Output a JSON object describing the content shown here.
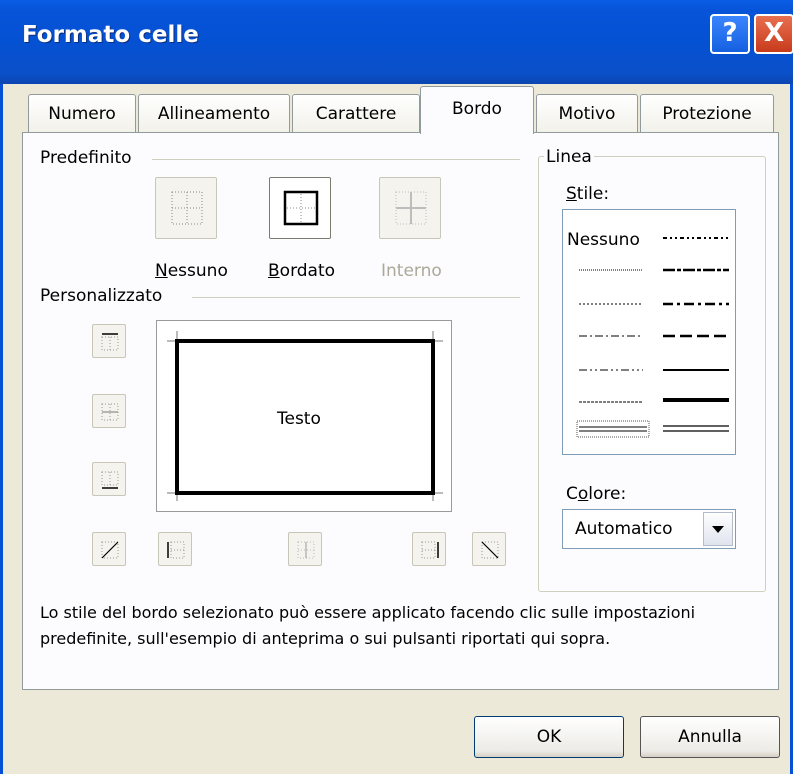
{
  "window": {
    "title": "Formato celle",
    "help_glyph": "?",
    "close_glyph": "X"
  },
  "tabs": [
    {
      "label": "Numero"
    },
    {
      "label": "Allineamento"
    },
    {
      "label": "Carattere"
    },
    {
      "label": "Bordo",
      "active": true
    },
    {
      "label": "Motivo"
    },
    {
      "label": "Protezione"
    }
  ],
  "predefinito": {
    "group_label": "Predefinito",
    "presets": [
      {
        "label_first": "N",
        "label_rest": "essuno",
        "icon": "preset-none-icon"
      },
      {
        "label_first": "B",
        "label_rest": "ordato",
        "icon": "preset-outline-icon"
      },
      {
        "label": "Interno",
        "icon": "preset-inside-icon",
        "disabled": true
      }
    ]
  },
  "personalizzato": {
    "group_label": "Personalizzato",
    "preview_text": "Testo"
  },
  "linea": {
    "group_label": "Linea",
    "stile_first": "S",
    "stile_rest": "tile:",
    "stile_none_option": "Nessuno",
    "colore_head": "C",
    "colore_underlined": "o",
    "colore_rest": "lore:",
    "colore_value": "Automatico"
  },
  "hint_text": "Lo stile del bordo selezionato può essere applicato facendo clic sulle impostazioni predefinite, sull'esempio di anteprima o sui pulsanti riportati qui sopra.",
  "buttons": {
    "ok": "OK",
    "cancel": "Annulla"
  },
  "colors": {
    "title_bar": "#0550d4",
    "dialog_bg": "#ece9d8",
    "panel_bg": "#fcfcfe",
    "close_red": "#c73b1c"
  }
}
